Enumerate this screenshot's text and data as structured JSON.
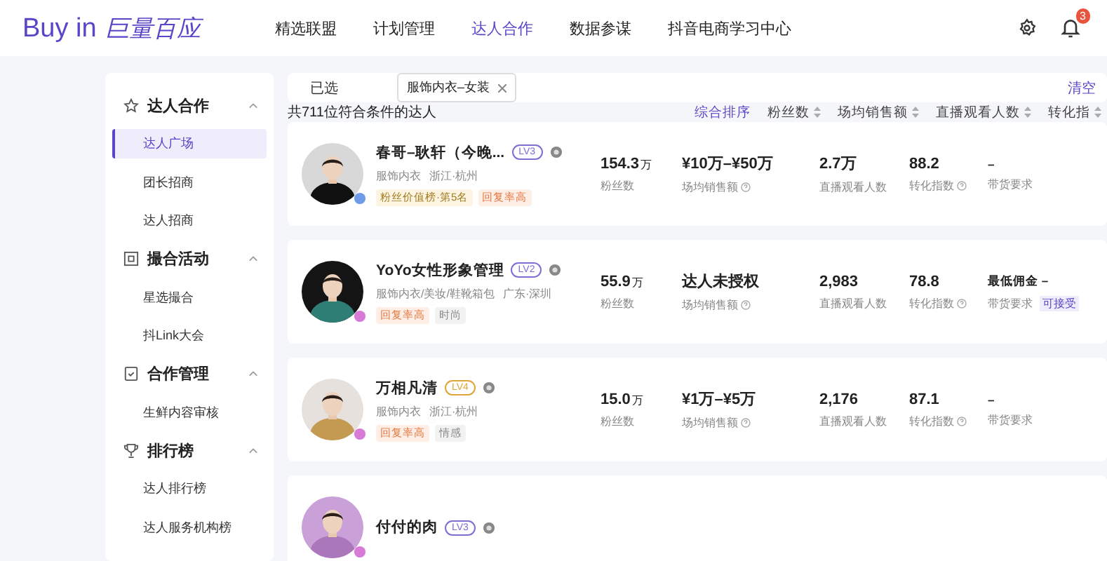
{
  "header": {
    "logo_latin": "Buy in",
    "logo_cn": "巨量百应",
    "nav": [
      {
        "label": "精选联盟",
        "selected": false
      },
      {
        "label": "计划管理",
        "selected": false
      },
      {
        "label": "达人合作",
        "selected": true
      },
      {
        "label": "数据参谋",
        "selected": false
      },
      {
        "label": "抖音电商学习中心",
        "selected": false
      }
    ],
    "notification_count": "3"
  },
  "sidebar": [
    {
      "title": "达人合作",
      "expanded": true,
      "items": [
        {
          "label": "达人广场",
          "selected": true
        },
        {
          "label": "团长招商",
          "selected": false
        },
        {
          "label": "达人招商",
          "selected": false
        }
      ]
    },
    {
      "title": "撮合活动",
      "expanded": true,
      "items": [
        {
          "label": "星选撮合",
          "selected": false
        },
        {
          "label": "抖Link大会",
          "selected": false
        }
      ]
    },
    {
      "title": "合作管理",
      "expanded": true,
      "items": [
        {
          "label": "生鲜内容审核",
          "selected": false
        }
      ]
    },
    {
      "title": "排行榜",
      "expanded": true,
      "items": [
        {
          "label": "达人排行榜",
          "selected": false
        },
        {
          "label": "达人服务机构榜",
          "selected": false
        }
      ]
    }
  ],
  "filter": {
    "label": "已选",
    "chips": [
      "服饰内衣–女装"
    ],
    "clear": "清空"
  },
  "result_count": "共711位符合条件的达人",
  "sorts": [
    {
      "label": "综合排序",
      "selected": true
    },
    {
      "label": "粉丝数",
      "selected": false
    },
    {
      "label": "场均销售额",
      "selected": false
    },
    {
      "label": "直播观看人数",
      "selected": false
    },
    {
      "label": "转化指",
      "selected": false
    }
  ],
  "creators": [
    {
      "name": "春哥–耿轩（今晚...",
      "level": {
        "text": "LV3",
        "color": "#7b6fd6"
      },
      "avatar_badge": {
        "color": "#6f9be8"
      },
      "category": "服饰内衣",
      "location": "浙江·杭州",
      "tags": [
        {
          "kind": "rank",
          "text": "粉丝价值榜·第5名"
        },
        {
          "kind": "warm",
          "text": "回复率高"
        }
      ],
      "fans": "154.3",
      "fans_unit": "万",
      "fans_label": "粉丝数",
      "sales": "¥10万–¥50万",
      "sales_label": "场均销售额",
      "viewers": "2.7万",
      "viewers_label": "直播观看人数",
      "conversion": "88.2",
      "conversion_label": "转化指数",
      "requirement_title": "–",
      "requirement_label": "带货要求"
    },
    {
      "name": "YoYo女性形象管理",
      "level": {
        "text": "LV2",
        "color": "#7b6fd6"
      },
      "avatar_badge": {
        "color": "#d77bd6"
      },
      "category": "服饰内衣/美妆/鞋靴箱包",
      "location": "广东·深圳",
      "tags": [
        {
          "kind": "warm",
          "text": "回复率高"
        },
        {
          "kind": "plain",
          "text": "时尚"
        }
      ],
      "fans": "55.9",
      "fans_unit": "万",
      "fans_label": "粉丝数",
      "sales": "达人未授权",
      "sales_label": "场均销售额",
      "viewers": "2,983",
      "viewers_label": "直播观看人数",
      "conversion": "78.8",
      "conversion_label": "转化指数",
      "requirement_title": "最低佣金 –",
      "requirement_label": "带货要求",
      "requirement_link": "可接受"
    },
    {
      "name": "万相凡清",
      "level": {
        "text": "LV4",
        "color": "#e0a537"
      },
      "avatar_badge": {
        "color": "#d77bd6"
      },
      "category": "服饰内衣",
      "location": "浙江·杭州",
      "tags": [
        {
          "kind": "warm",
          "text": "回复率高"
        },
        {
          "kind": "plain",
          "text": "情感"
        }
      ],
      "fans": "15.0",
      "fans_unit": "万",
      "fans_label": "粉丝数",
      "sales": "¥1万–¥5万",
      "sales_label": "场均销售额",
      "viewers": "2,176",
      "viewers_label": "直播观看人数",
      "conversion": "87.1",
      "conversion_label": "转化指数",
      "requirement_title": "–",
      "requirement_label": "带货要求"
    },
    {
      "name": "付付的肉",
      "level": {
        "text": "LV3",
        "color": "#7b6fd6"
      },
      "avatar_badge": {
        "color": "#d77bd6"
      }
    }
  ]
}
